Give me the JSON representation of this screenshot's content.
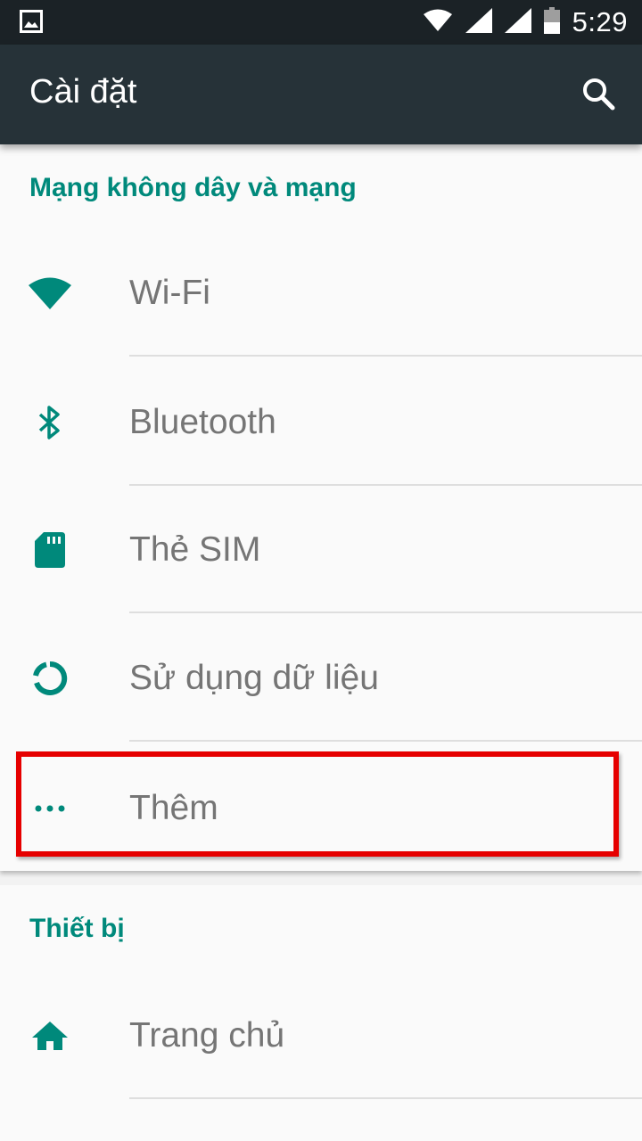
{
  "status_bar": {
    "time": "5:29",
    "icons": [
      "image-notification-icon",
      "wifi-signal-icon",
      "cell-signal-icon",
      "cell-signal-2-icon",
      "battery-icon"
    ]
  },
  "toolbar": {
    "title": "Cài đặt",
    "search_icon": "search-icon"
  },
  "sections": {
    "network": {
      "header": "Mạng không dây và mạng",
      "items": [
        {
          "label": "Wi-Fi",
          "icon": "wifi-icon"
        },
        {
          "label": "Bluetooth",
          "icon": "bluetooth-icon"
        },
        {
          "label": "Thẻ SIM",
          "icon": "sim-card-icon"
        },
        {
          "label": "Sử dụng dữ liệu",
          "icon": "data-usage-icon"
        },
        {
          "label": "Thêm",
          "icon": "more-dots-icon"
        }
      ]
    },
    "device": {
      "header": "Thiết bị",
      "items": [
        {
          "label": "Trang chủ",
          "icon": "home-icon"
        }
      ]
    }
  },
  "colors": {
    "accent": "#00897b",
    "toolbar": "#263238",
    "status_bar": "#1b2226",
    "highlight": "#e60000"
  }
}
